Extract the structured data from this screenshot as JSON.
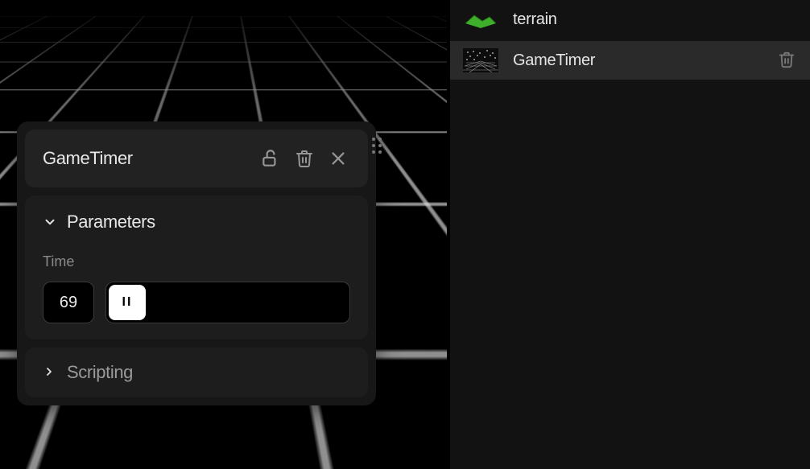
{
  "hierarchy": {
    "items": [
      {
        "label": "terrain",
        "icon": "terrain",
        "selected": false
      },
      {
        "label": "GameTimer",
        "icon": "gametimer",
        "selected": true
      }
    ]
  },
  "inspector": {
    "title": "GameTimer",
    "sections": {
      "parameters": {
        "label": "Parameters",
        "expanded": true
      },
      "scripting": {
        "label": "Scripting",
        "expanded": false
      }
    },
    "param": {
      "label": "Time",
      "value": "69",
      "thumb_glyph": "II"
    }
  }
}
